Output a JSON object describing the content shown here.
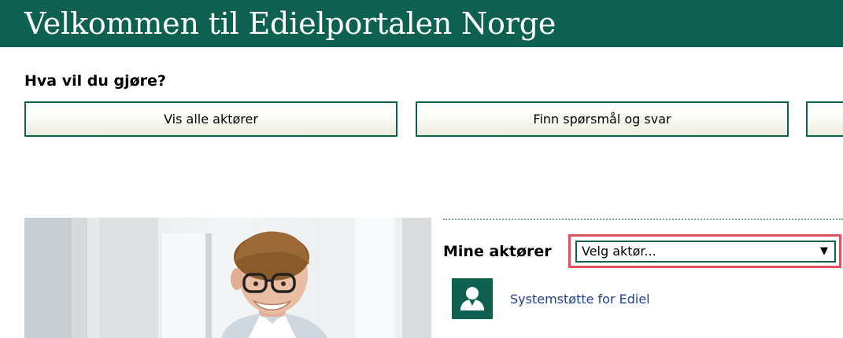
{
  "banner": {
    "title": "Velkommen til Edielportalen Norge"
  },
  "intro": {
    "question": "Hva vil du gjøre?"
  },
  "actions": [
    {
      "label": "Vis alle aktører"
    },
    {
      "label": "Finn spørsmål og svar"
    },
    {
      "label": ""
    }
  ],
  "mine_aktorer": {
    "title": "Mine aktører",
    "select": {
      "value": "Velg aktør...",
      "arrow": "▼"
    },
    "items": [
      {
        "label": "Systemstøtte for Ediel",
        "icon": "person-icon"
      }
    ]
  },
  "colors": {
    "brand_green": "#0e6150",
    "highlight_red": "#e0525e",
    "link_blue": "#1f3f8f"
  }
}
